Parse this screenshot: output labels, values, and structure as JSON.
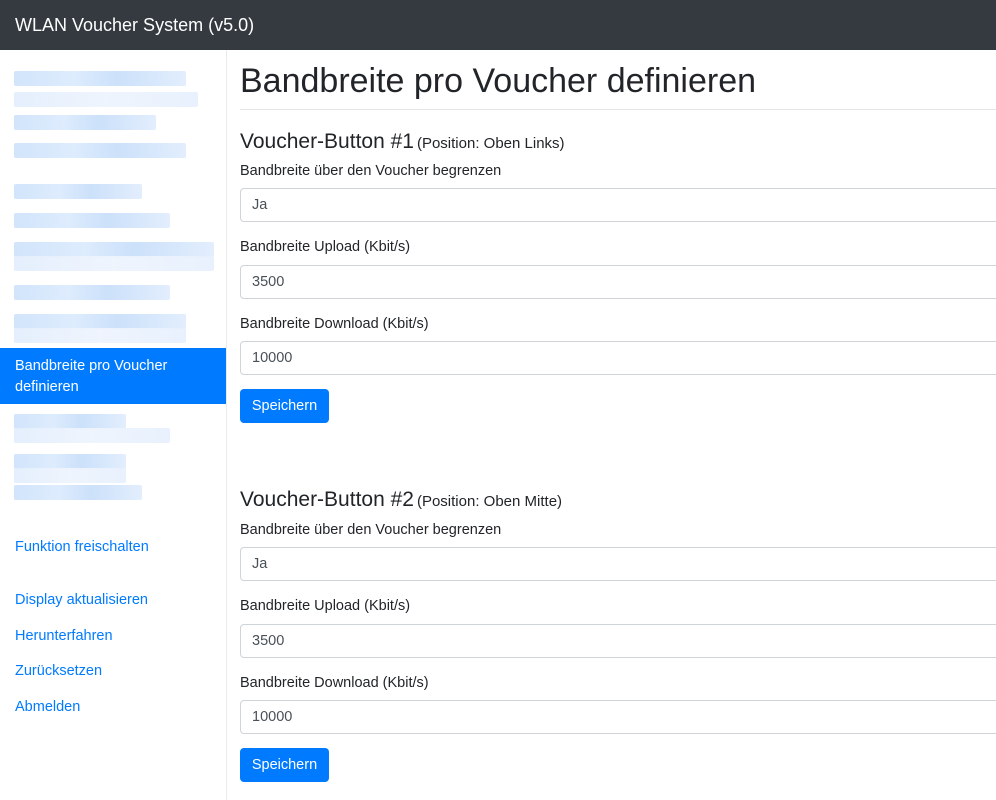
{
  "app": {
    "title": "WLAN Voucher System (v5.0)"
  },
  "sidebar": {
    "active_item": "Bandbreite pro Voucher definieren",
    "links": [
      "Funktion freischalten",
      "Display aktualisieren",
      "Herunterfahren",
      "Zurücksetzen",
      "Abmelden"
    ]
  },
  "main": {
    "title": "Bandbreite pro Voucher definieren",
    "sections": [
      {
        "title": "Voucher-Button #1",
        "subtitle": "(Position: Oben Links)",
        "fields": [
          {
            "label": "Bandbreite über den Voucher begrenzen",
            "value": "Ja"
          },
          {
            "label": "Bandbreite Upload (Kbit/s)",
            "value": "3500"
          },
          {
            "label": "Bandbreite Download (Kbit/s)",
            "value": "10000"
          }
        ],
        "save_label": "Speichern"
      },
      {
        "title": "Voucher-Button #2",
        "subtitle": "(Position: Oben Mitte)",
        "fields": [
          {
            "label": "Bandbreite über den Voucher begrenzen",
            "value": "Ja"
          },
          {
            "label": "Bandbreite Upload (Kbit/s)",
            "value": "3500"
          },
          {
            "label": "Bandbreite Download (Kbit/s)",
            "value": "10000"
          }
        ],
        "save_label": "Speichern"
      }
    ]
  }
}
